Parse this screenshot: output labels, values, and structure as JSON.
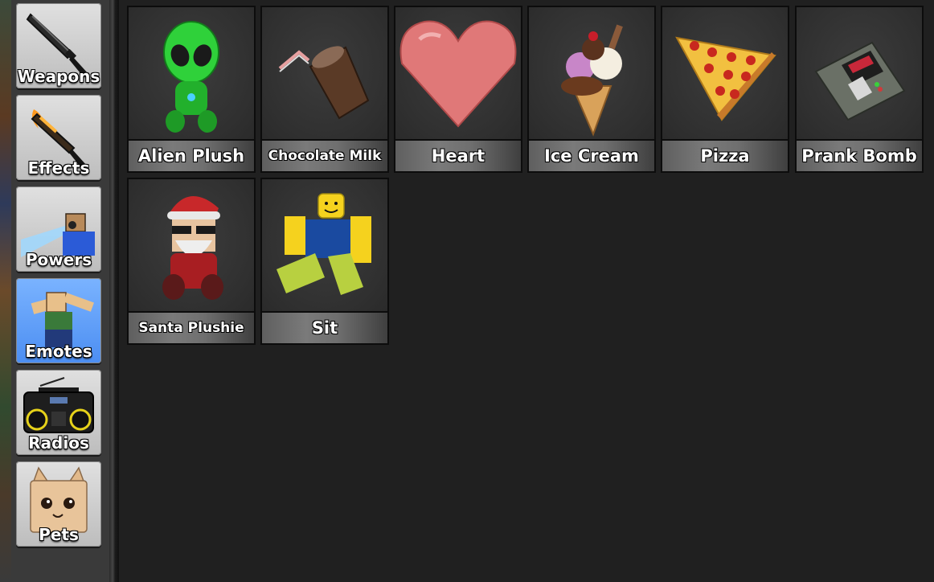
{
  "sidebar": {
    "categories": [
      {
        "label": "Weapons",
        "icon": "knife-icon",
        "active": false
      },
      {
        "label": "Effects",
        "icon": "flaming-knife-icon",
        "active": false
      },
      {
        "label": "Powers",
        "icon": "laser-character-icon",
        "active": false
      },
      {
        "label": "Emotes",
        "icon": "dab-character-icon",
        "active": true
      },
      {
        "label": "Radios",
        "icon": "boombox-icon",
        "active": false
      },
      {
        "label": "Pets",
        "icon": "cat-head-icon",
        "active": false
      }
    ]
  },
  "emotes": {
    "items": [
      {
        "label": "Alien Plush",
        "icon": "alien-plush-icon"
      },
      {
        "label": "Chocolate Milk",
        "icon": "chocolate-milk-icon"
      },
      {
        "label": "Heart",
        "icon": "heart-icon"
      },
      {
        "label": "Ice Cream",
        "icon": "ice-cream-icon"
      },
      {
        "label": "Pizza",
        "icon": "pizza-slice-icon"
      },
      {
        "label": "Prank Bomb",
        "icon": "prank-bomb-icon"
      },
      {
        "label": "Santa Plushie",
        "icon": "santa-plushie-icon"
      },
      {
        "label": "Sit",
        "icon": "sitting-character-icon"
      }
    ]
  },
  "colors": {
    "active_category": "#4c8ef2",
    "inactive_category": "#cfcfcf",
    "panel_background": "#202020"
  }
}
